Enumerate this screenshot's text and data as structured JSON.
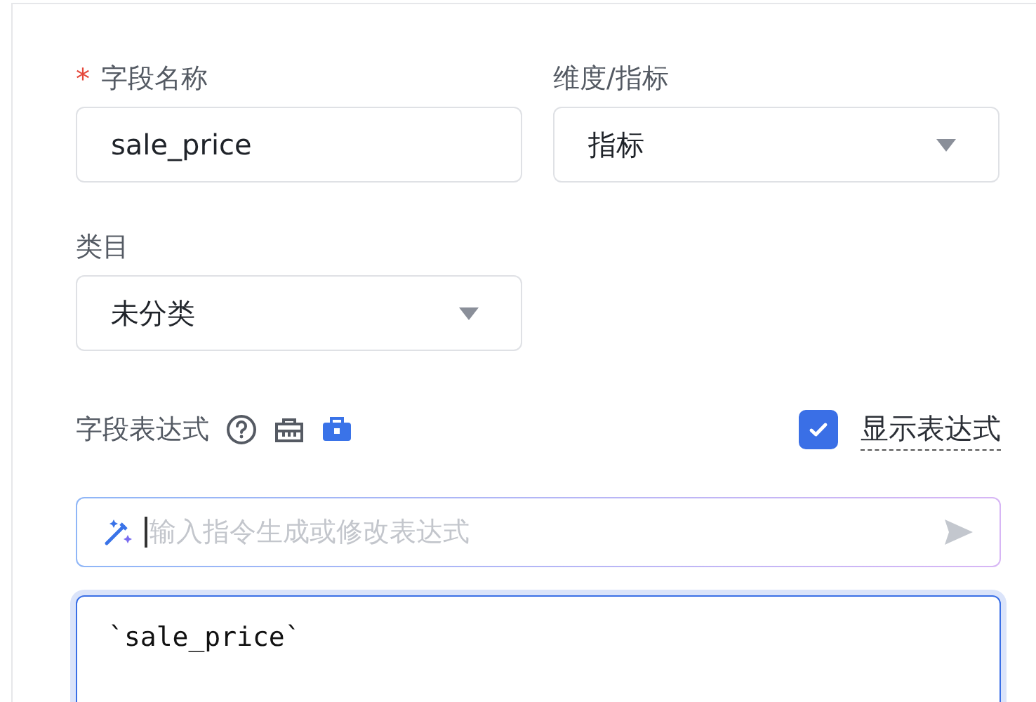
{
  "fields": [
    {
      "label": "字段名称",
      "required_mark": "*",
      "kind": "text",
      "value": "sale_price"
    },
    {
      "label": "维度/指标",
      "kind": "select",
      "value": "指标"
    },
    {
      "label": "类目",
      "kind": "select",
      "value": "未分类"
    }
  ],
  "expression": {
    "label": "字段表达式",
    "show_expression": {
      "label": "显示表达式",
      "checked": true
    },
    "ai_prompt": {
      "placeholder": "输入指令生成或修改表达式"
    },
    "editor": {
      "value": "`sale_price`",
      "focused": true
    }
  }
}
